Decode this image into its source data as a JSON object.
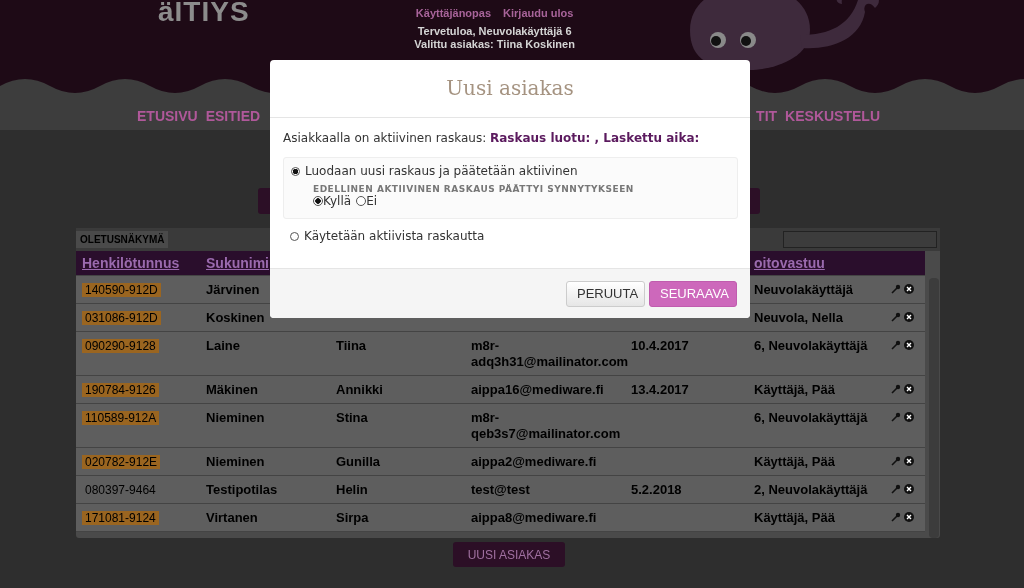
{
  "header": {
    "logo": "äITIYS",
    "links": [
      "Käyttäjänopas",
      "Kirjaudu ulos"
    ],
    "welcome": "Tervetuloa, Neuvolakäyttäjä 6",
    "selected_client": "Valittu asiakas: Tiina Koskinen"
  },
  "nav": {
    "left": [
      "ETUSIVU",
      "ESITIED"
    ],
    "right": [
      "TIT",
      "KESKUSTELU"
    ]
  },
  "view_label": "OLETUSNÄKYMÄ",
  "table": {
    "columns": [
      "Henkilötunnus",
      "Sukunimi",
      null,
      null,
      null,
      "oitovastuu"
    ],
    "rows": [
      {
        "highlighted": true,
        "cells": [
          "140590-912D",
          "Järvinen",
          null,
          null,
          null,
          "Neuvolakäyttäjä"
        ]
      },
      {
        "highlighted": true,
        "cells": [
          "031086-912D",
          "Koskinen",
          null,
          null,
          null,
          "Neuvola, Nella"
        ]
      },
      {
        "highlighted": true,
        "cells": [
          "090290-9128",
          "Laine",
          "Tiina",
          "m8r-adq3h31@mailinator.com",
          "10.4.2017",
          "6, Neuvolakäyttäjä"
        ]
      },
      {
        "highlighted": true,
        "cells": [
          "190784-9126",
          "Mäkinen",
          "Annikki",
          "aippa16@mediware.fi",
          "13.4.2017",
          "Käyttäjä, Pää"
        ]
      },
      {
        "highlighted": true,
        "cells": [
          "110589-912A",
          "Nieminen",
          "Stina",
          "m8r-qeb3s7@mailinator.com",
          null,
          "6, Neuvolakäyttäjä"
        ]
      },
      {
        "highlighted": true,
        "cells": [
          "020782-912E",
          "Nieminen",
          "Gunilla",
          "aippa2@mediware.fi",
          null,
          "Käyttäjä, Pää"
        ]
      },
      {
        "highlighted": false,
        "cells": [
          "080397-9464",
          "Testipotilas",
          "Helin",
          "test@test",
          "5.2.2018",
          "2, Neuvolakäyttäjä"
        ]
      },
      {
        "highlighted": true,
        "cells": [
          "171081-9124",
          "Virtanen",
          "Sirpa",
          "aippa8@mediware.fi",
          null,
          "Käyttäjä, Pää"
        ]
      }
    ]
  },
  "new_client_button": "UUSI ASIAKAS",
  "modal": {
    "title": "Uusi asiakas",
    "message": "Asiakkaalla on aktiivinen raskaus: **Raskaus luotu: , Laskettu aika:**",
    "options": [
      {
        "label": "Luodaan uusi raskaus ja päätetään aktiivinen",
        "selected": true,
        "question": "EDELLINEN AKTIIVINEN RASKAUS PÄÄTTYI SYNNYTYKSEEN",
        "answers": [
          {
            "label": "Kyllä",
            "selected": true
          },
          {
            "label": "Ei",
            "selected": false
          }
        ]
      },
      {
        "label": "Käytetään aktiivista raskautta",
        "selected": false
      }
    ],
    "buttons": [
      {
        "label": "PERUUTA",
        "kind": "secondary"
      },
      {
        "label": "SEURAAVA",
        "kind": "primary"
      }
    ]
  }
}
